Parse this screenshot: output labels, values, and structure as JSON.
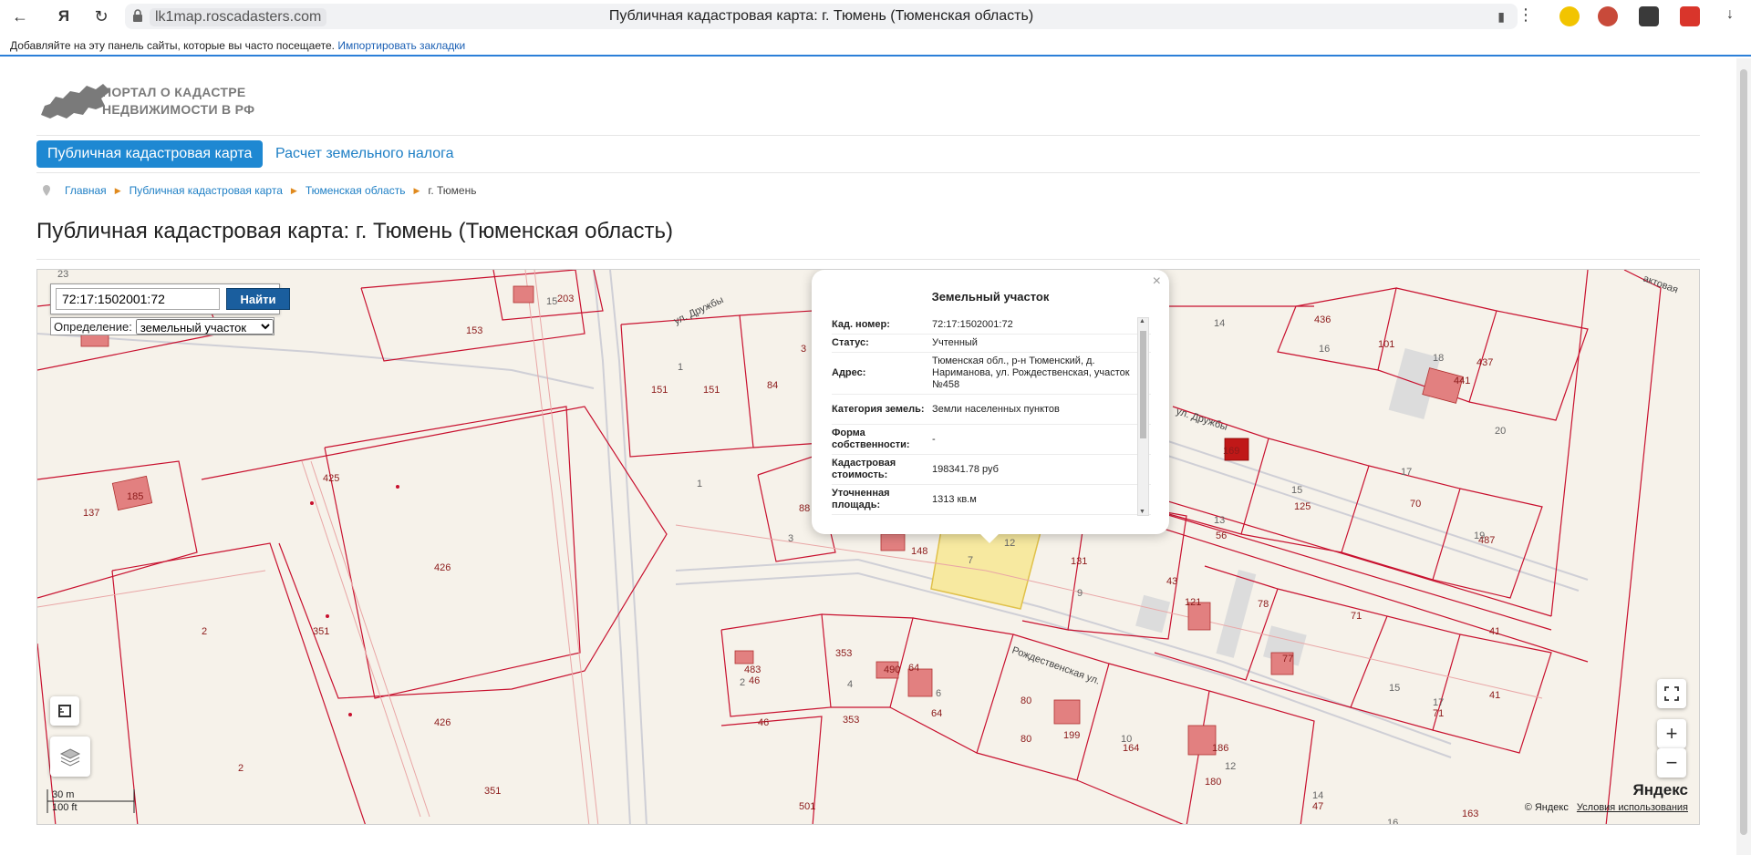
{
  "browser": {
    "url": "lk1map.roscadasters.com",
    "tab_title": "Публичная кадастровая карта: г. Тюмень (Тюменская область)",
    "bookmarks_hint": "Добавляйте на эту панель сайты, которые вы часто посещаете.",
    "bookmarks_link": "Импортировать закладки"
  },
  "logo": {
    "line1": "ПОРТАЛ О КАДАСТРЕ",
    "line2": "НЕДВИЖИМОСТИ В РФ"
  },
  "nav": {
    "active": "Публичная кадастровая карта",
    "second": "Расчет земельного налога"
  },
  "breadcrumb": {
    "home": "Главная",
    "map": "Публичная кадастровая карта",
    "region": "Тюменская область",
    "city": "г. Тюмень"
  },
  "page_title": "Публичная кадастровая карта: г. Тюмень (Тюменская область)",
  "map": {
    "search_value": "72:17:1502001:72",
    "search_button": "Найти",
    "definition_label": "Определение:",
    "definition_value": "земельный участок",
    "scale_m": "30 m",
    "scale_ft": "100 ft",
    "copyright": "© Яндекс",
    "terms": "Условия использования",
    "brand": "Яндекс",
    "streets": {
      "druzhby_1": "ул. Дружбы",
      "druzhby_2": "ул. Дружбы",
      "rozhdestvenskaya": "Рождественская ул.",
      "edge": "актовая"
    }
  },
  "popup": {
    "title": "Земельный участок",
    "rows": [
      {
        "k": "Кад. номер:",
        "v": "72:17:1502001:72"
      },
      {
        "k": "Статус:",
        "v": "Учтенный"
      },
      {
        "k": "Адрес:",
        "v": "Тюменская обл., р-н Тюменский, д. Нариманова, ул. Рождественская, участок №458"
      },
      {
        "k": "Категория земель:",
        "v": "Земли населенных пунктов"
      },
      {
        "k": "Форма собственности:",
        "v": "-"
      },
      {
        "k": "Кадастровая стоимость:",
        "v": "198341.78 руб"
      },
      {
        "k": "Уточненная площадь:",
        "v": "1313 кв.м"
      }
    ]
  },
  "colors": {
    "accent": "#1e88d2",
    "parcel_line": "#c8102e",
    "selected_parcel": "#f7e9a0"
  }
}
